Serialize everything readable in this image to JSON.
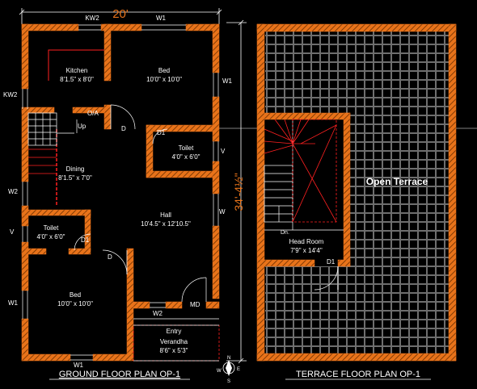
{
  "plans": {
    "ground_title": "GROUND FLOOR PLAN OP-1",
    "terrace_title": "TERRACE FLOOR PLAN OP-1"
  },
  "dimensions": {
    "width": "20'",
    "depth": "34'-4½\""
  },
  "rooms": {
    "kitchen": {
      "name": "Kitchen",
      "size": "8'1.5\" x 8'0\""
    },
    "bed_top": {
      "name": "Bed",
      "size": "10'0\" x 10'0\""
    },
    "toilet_right": {
      "name": "Toilet",
      "size": "4'0\" x 6'0\""
    },
    "dining": {
      "name": "Dining",
      "size": "8'1.5\" x 7'0\""
    },
    "hall": {
      "name": "Hall",
      "size": "10'4.5\" x 12'10.5\""
    },
    "toilet_left": {
      "name": "Toilet",
      "size": "4'0\" x 6'0\""
    },
    "bed_bottom": {
      "name": "Bed",
      "size": "10'0\" x 10'0\""
    },
    "entry": {
      "name": "Entry"
    },
    "verandha": {
      "name": "Verandha",
      "size": "8'6\" x 5'3\""
    },
    "open_terrace": {
      "name": "Open Terrace"
    },
    "head_room": {
      "name": "Head Room",
      "size": "7'9\" x 14'4\""
    }
  },
  "openings": {
    "kw2_top": "KW2",
    "w1_top": "W1",
    "w1_right": "W1",
    "kw2_left": "KW2",
    "oa": "O/A",
    "up": "Up",
    "d_bed": "D",
    "d1_toilet": "D1",
    "v_right": "V",
    "w2_left": "W2",
    "w_right": "W",
    "v_left": "V",
    "d1_toilet_left": "D1",
    "d_bed_bottom": "D",
    "w1_left": "W1",
    "w2_bottom": "W2",
    "md": "MD",
    "w1_bottom": "W1",
    "dn": "Dn.",
    "d1_head": "D1",
    "compass_w": "W",
    "compass_e": "E",
    "compass_n": "N",
    "compass_s": "S"
  },
  "colors": {
    "wall": "#e8731a",
    "hatch": "#5a2a00",
    "grid": "#8a8a8a",
    "stair_red": "#ff2020",
    "background": "#000000",
    "line": "#ffffff"
  }
}
